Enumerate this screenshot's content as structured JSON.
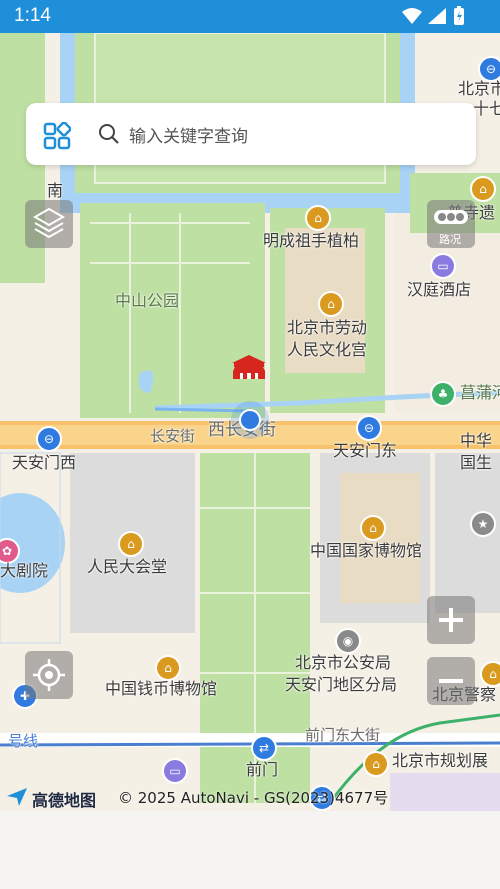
{
  "status_bar": {
    "time": "1:14"
  },
  "search": {
    "placeholder": "输入关键字查询"
  },
  "controls": {
    "traffic_label": "路况"
  },
  "map_labels": {
    "zhongshan_park": "中山公园",
    "mingcheng_tree": "明成祖手植柏",
    "workers_palace_1": "北京市劳动",
    "workers_palace_2": "人民文化宫",
    "hanting": "汉庭酒店",
    "changpu": "菖蒲河",
    "changan": "长安街",
    "xichangan": "西长安街",
    "tiananmen_west": "天安门西",
    "tiananmen_east": "天安门东",
    "great_hall": "人民大会堂",
    "museum": "中国国家博物馆",
    "opera": "大剧院",
    "zhonghua_1": "中华",
    "zhonghua_2": "国生",
    "police_1": "北京市公安局",
    "police_2": "天安门地区分局",
    "coin_museum": "中国钱币博物馆",
    "qianmen_east": "前门东大街",
    "qianmen": "前门",
    "planning": "北京市规划展",
    "police_museum": "北京警察",
    "line2": "号线",
    "nan": "南",
    "beijing_top": "北京市",
    "top_frag": "十七",
    "temple": "普寺遗"
  },
  "attribution": {
    "logo": "高德地图",
    "copyright": "© 2025 AutoNavi - GS(2023)4677号"
  },
  "colors": {
    "status_bar": "#1f8fd9",
    "park": "#bfe0a3",
    "water": "#a8d3f5",
    "road": "#f7c26b",
    "subway_blue": "#4a7fd0",
    "location": "#2f7be0"
  }
}
